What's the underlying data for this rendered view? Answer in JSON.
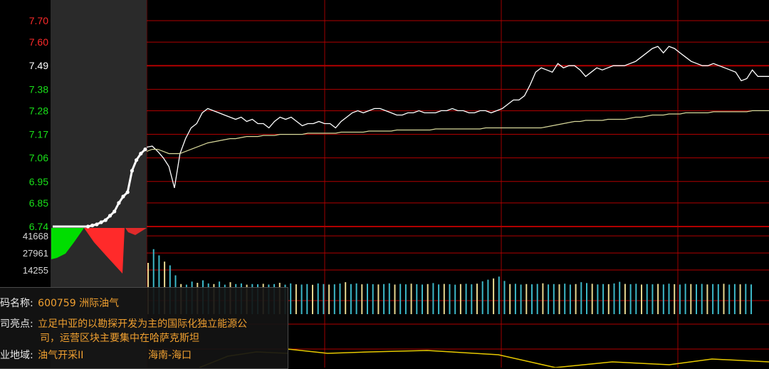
{
  "chart_data": {
    "type": "line",
    "price_axis": {
      "ticks": [
        "7.70",
        "7.60",
        "7.49",
        "7.38",
        "7.28",
        "7.17",
        "7.06",
        "6.95",
        "6.85",
        "6.74"
      ],
      "reference": "7.49",
      "range": [
        6.74,
        7.77
      ]
    },
    "volume_axis": {
      "ticks": [
        "41668",
        "27961",
        "14255"
      ]
    },
    "colors": {
      "up": "#ff2a2a",
      "down": "#00dd00",
      "price_line": "#ffffff",
      "avg_line": "#d8d89a",
      "grid": "#b00000",
      "reference_line": "#c40000",
      "auction_shade": "#2a2a2a",
      "volume_cyan": "#3cb8c8",
      "volume_yellow": "#e8d890",
      "indicator": "#e6c800"
    },
    "series": [
      {
        "values": [
          7.11,
          7.115,
          7.09,
          7.06,
          7.02,
          6.92,
          7.08,
          7.15,
          7.2,
          7.22,
          7.27,
          7.29,
          7.28,
          7.27,
          7.26,
          7.25,
          7.24,
          7.25,
          7.23,
          7.24,
          7.22,
          7.22,
          7.2,
          7.23,
          7.25,
          7.24,
          7.25,
          7.23,
          7.21,
          7.22,
          7.22,
          7.23,
          7.22,
          7.22,
          7.2,
          7.23,
          7.25,
          7.27,
          7.28,
          7.27,
          7.28,
          7.29,
          7.29,
          7.28,
          7.27,
          7.26,
          7.26,
          7.27,
          7.27,
          7.28,
          7.27,
          7.27,
          7.27,
          7.28,
          7.28,
          7.29,
          7.28,
          7.28,
          7.27,
          7.27,
          7.28,
          7.28,
          7.27,
          7.28,
          7.29,
          7.31,
          7.33,
          7.33,
          7.35,
          7.4,
          7.46,
          7.48,
          7.47,
          7.46,
          7.5,
          7.48,
          7.49,
          7.49,
          7.47,
          7.44,
          7.46,
          7.48,
          7.47,
          7.48,
          7.49,
          7.49,
          7.49,
          7.5,
          7.51,
          7.53,
          7.55,
          7.57,
          7.58,
          7.55,
          7.58,
          7.57,
          7.55,
          7.53,
          7.51,
          7.5,
          7.49,
          7.49,
          7.5,
          7.49,
          7.48,
          7.47,
          7.46,
          7.42,
          7.43,
          7.47,
          7.44,
          7.44,
          7.44
        ]
      },
      {
        "values": [
          7.09,
          7.1,
          7.1,
          7.09,
          7.08,
          7.08,
          7.08,
          7.09,
          7.1,
          7.11,
          7.12,
          7.13,
          7.135,
          7.14,
          7.145,
          7.15,
          7.15,
          7.155,
          7.16,
          7.16,
          7.16,
          7.165,
          7.165,
          7.165,
          7.17,
          7.17,
          7.17,
          7.17,
          7.17,
          7.175,
          7.175,
          7.175,
          7.175,
          7.175,
          7.175,
          7.18,
          7.18,
          7.18,
          7.18,
          7.18,
          7.185,
          7.185,
          7.185,
          7.185,
          7.185,
          7.19,
          7.19,
          7.19,
          7.19,
          7.19,
          7.19,
          7.19,
          7.195,
          7.195,
          7.195,
          7.195,
          7.195,
          7.195,
          7.195,
          7.195,
          7.195,
          7.2,
          7.2,
          7.2,
          7.2,
          7.2,
          7.2,
          7.2,
          7.2,
          7.2,
          7.2,
          7.2,
          7.205,
          7.21,
          7.215,
          7.22,
          7.225,
          7.23,
          7.23,
          7.235,
          7.235,
          7.235,
          7.235,
          7.24,
          7.24,
          7.24,
          7.24,
          7.245,
          7.25,
          7.25,
          7.255,
          7.26,
          7.26,
          7.26,
          7.265,
          7.265,
          7.265,
          7.27,
          7.27,
          7.27,
          7.27,
          7.27,
          7.275,
          7.275,
          7.275,
          7.275,
          7.275,
          7.275,
          7.275,
          7.28,
          7.28,
          7.28,
          7.28
        ]
      }
    ],
    "auction": {
      "values": [
        6.74,
        6.74,
        6.74,
        6.74,
        6.74,
        6.74,
        6.74,
        6.74,
        6.74,
        6.745,
        6.75,
        6.76,
        6.77,
        6.79,
        6.81,
        6.85,
        6.88,
        6.9,
        7.0,
        7.05,
        7.08,
        7.1
      ]
    },
    "volume": [
      20000,
      31000,
      26000,
      21000,
      18000,
      10000,
      3000,
      2500,
      5000,
      4000,
      6000,
      3500,
      3000,
      5000,
      2500,
      4500,
      3000,
      3500,
      2500,
      3000,
      2800,
      3200,
      2600,
      3000,
      4000,
      2500,
      3500,
      2800,
      2600,
      3000,
      2400,
      3500,
      3000,
      2600,
      2800,
      3400,
      4500,
      3000,
      3500,
      2800,
      3200,
      2900,
      2700,
      3000,
      3600,
      2600,
      3100,
      2800,
      3300,
      2900,
      2600,
      3000,
      3800,
      2700,
      3100,
      2900,
      2500,
      3000,
      3200,
      2800,
      3300,
      5200,
      6500,
      7500,
      9000,
      5500,
      3000,
      3200,
      2600,
      3000,
      2800,
      3100,
      3600,
      2700,
      3000,
      2800,
      3300,
      2600,
      3000,
      4500,
      3800,
      3200,
      2700,
      3000,
      2900,
      3500,
      4800,
      3100,
      2900,
      3200,
      2600,
      3000,
      2800,
      3100,
      2700,
      3300,
      2900,
      2600,
      3200,
      3000,
      2800,
      3100,
      2700,
      3000,
      2900,
      3200,
      2600,
      3000,
      2800,
      3100,
      2700
    ]
  },
  "tooltip": {
    "code_label": "码名称:",
    "code_value": "600759 洲际油气",
    "highlight_label": "司亮点:",
    "highlight_text_1": "立足中亚的以勘探开发为主的国际化独立能源公",
    "highlight_text_2": "司，运营区块主要集中在哈萨克斯坦",
    "industry_label": "业地域:",
    "industry_value": "油气开采II",
    "region_value": "海南-海口"
  }
}
